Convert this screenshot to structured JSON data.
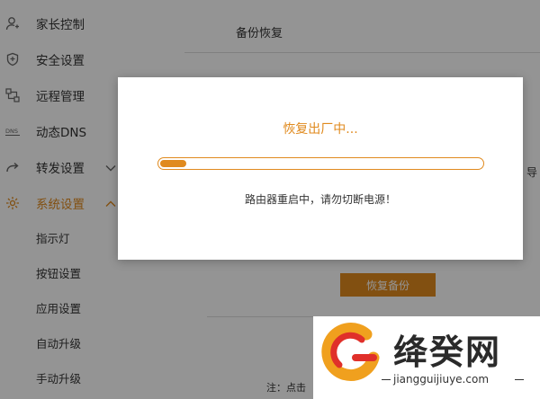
{
  "sidebar": {
    "items": [
      {
        "label": "家长控制",
        "icon": "user-icon"
      },
      {
        "label": "安全设置",
        "icon": "shield-icon"
      },
      {
        "label": "远程管理",
        "icon": "remote-icon"
      },
      {
        "label": "动态DNS",
        "icon": "dns-icon"
      },
      {
        "label": "转发设置",
        "icon": "forward-icon"
      },
      {
        "label": "系统设置",
        "icon": "gear-icon"
      }
    ],
    "sub_items": [
      "指示灯",
      "按钮设置",
      "应用设置",
      "自动升级",
      "手动升级"
    ]
  },
  "main": {
    "page_title": "备份恢复",
    "side_char": "导",
    "restore_button": "恢复备份",
    "note": "注：点击"
  },
  "modal": {
    "title": "恢复出厂中...",
    "progress": 0.08,
    "message": "路由器重启中，请勿切断电源！"
  },
  "watermark": {
    "name": "绛癸网",
    "url": "jiangguijiuye.com"
  },
  "colors": {
    "accent": "#e08a1e"
  }
}
